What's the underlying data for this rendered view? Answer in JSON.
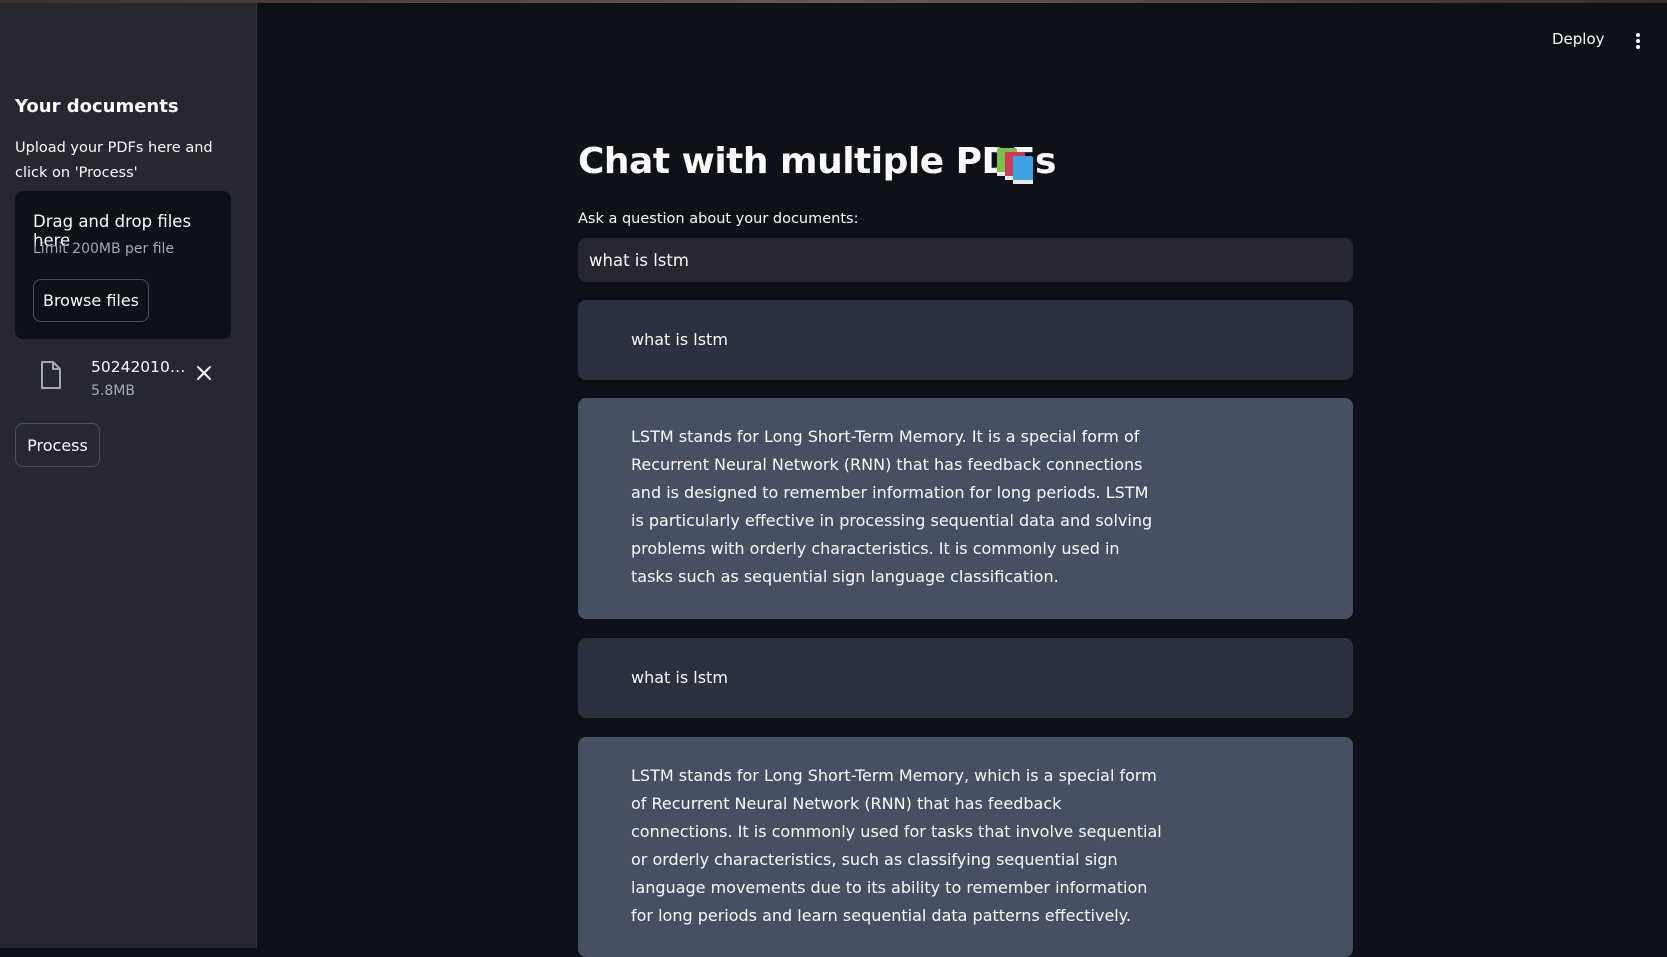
{
  "header": {
    "deploy_label": "Deploy",
    "menu_icon": "vertical-dots-icon"
  },
  "sidebar": {
    "title": "Your documents",
    "description": "Upload your PDFs here and click on 'Process'",
    "uploader": {
      "dropzone_title": "Drag and drop files here",
      "limit_text": "Limit 200MB per file",
      "browse_label": "Browse files"
    },
    "file": {
      "name": "502420105...",
      "size": "5.8MB",
      "icon": "file-icon"
    },
    "process_label": "Process"
  },
  "main": {
    "title": "Chat with multiple PDFs",
    "title_icon": "books-icon",
    "question_label": "Ask a question about your documents:",
    "question_value": "what is lstm",
    "messages": [
      {
        "role": "user",
        "text": "what is lstm"
      },
      {
        "role": "bot",
        "text": "LSTM stands for Long Short-Term Memory. It is a special form of Recurrent Neural Network (RNN) that has feedback connections and is designed to remember information for long periods. LSTM is particularly effective in processing sequential data and solving problems with orderly characteristics. It is commonly used in tasks such as sequential sign language classification."
      },
      {
        "role": "user",
        "text": "what is lstm"
      },
      {
        "role": "bot",
        "text": "LSTM stands for Long Short-Term Memory, which is a special form of Recurrent Neural Network (RNN) that has feedback connections. It is commonly used for tasks that involve sequential or orderly characteristics, such as classifying sequential sign language movements due to its ability to remember information for long periods and learn sequential data patterns effectively."
      }
    ]
  },
  "colors": {
    "background": "#0e1117",
    "sidebar": "#262730",
    "user_message": "#2b313e",
    "bot_message": "#475063"
  }
}
